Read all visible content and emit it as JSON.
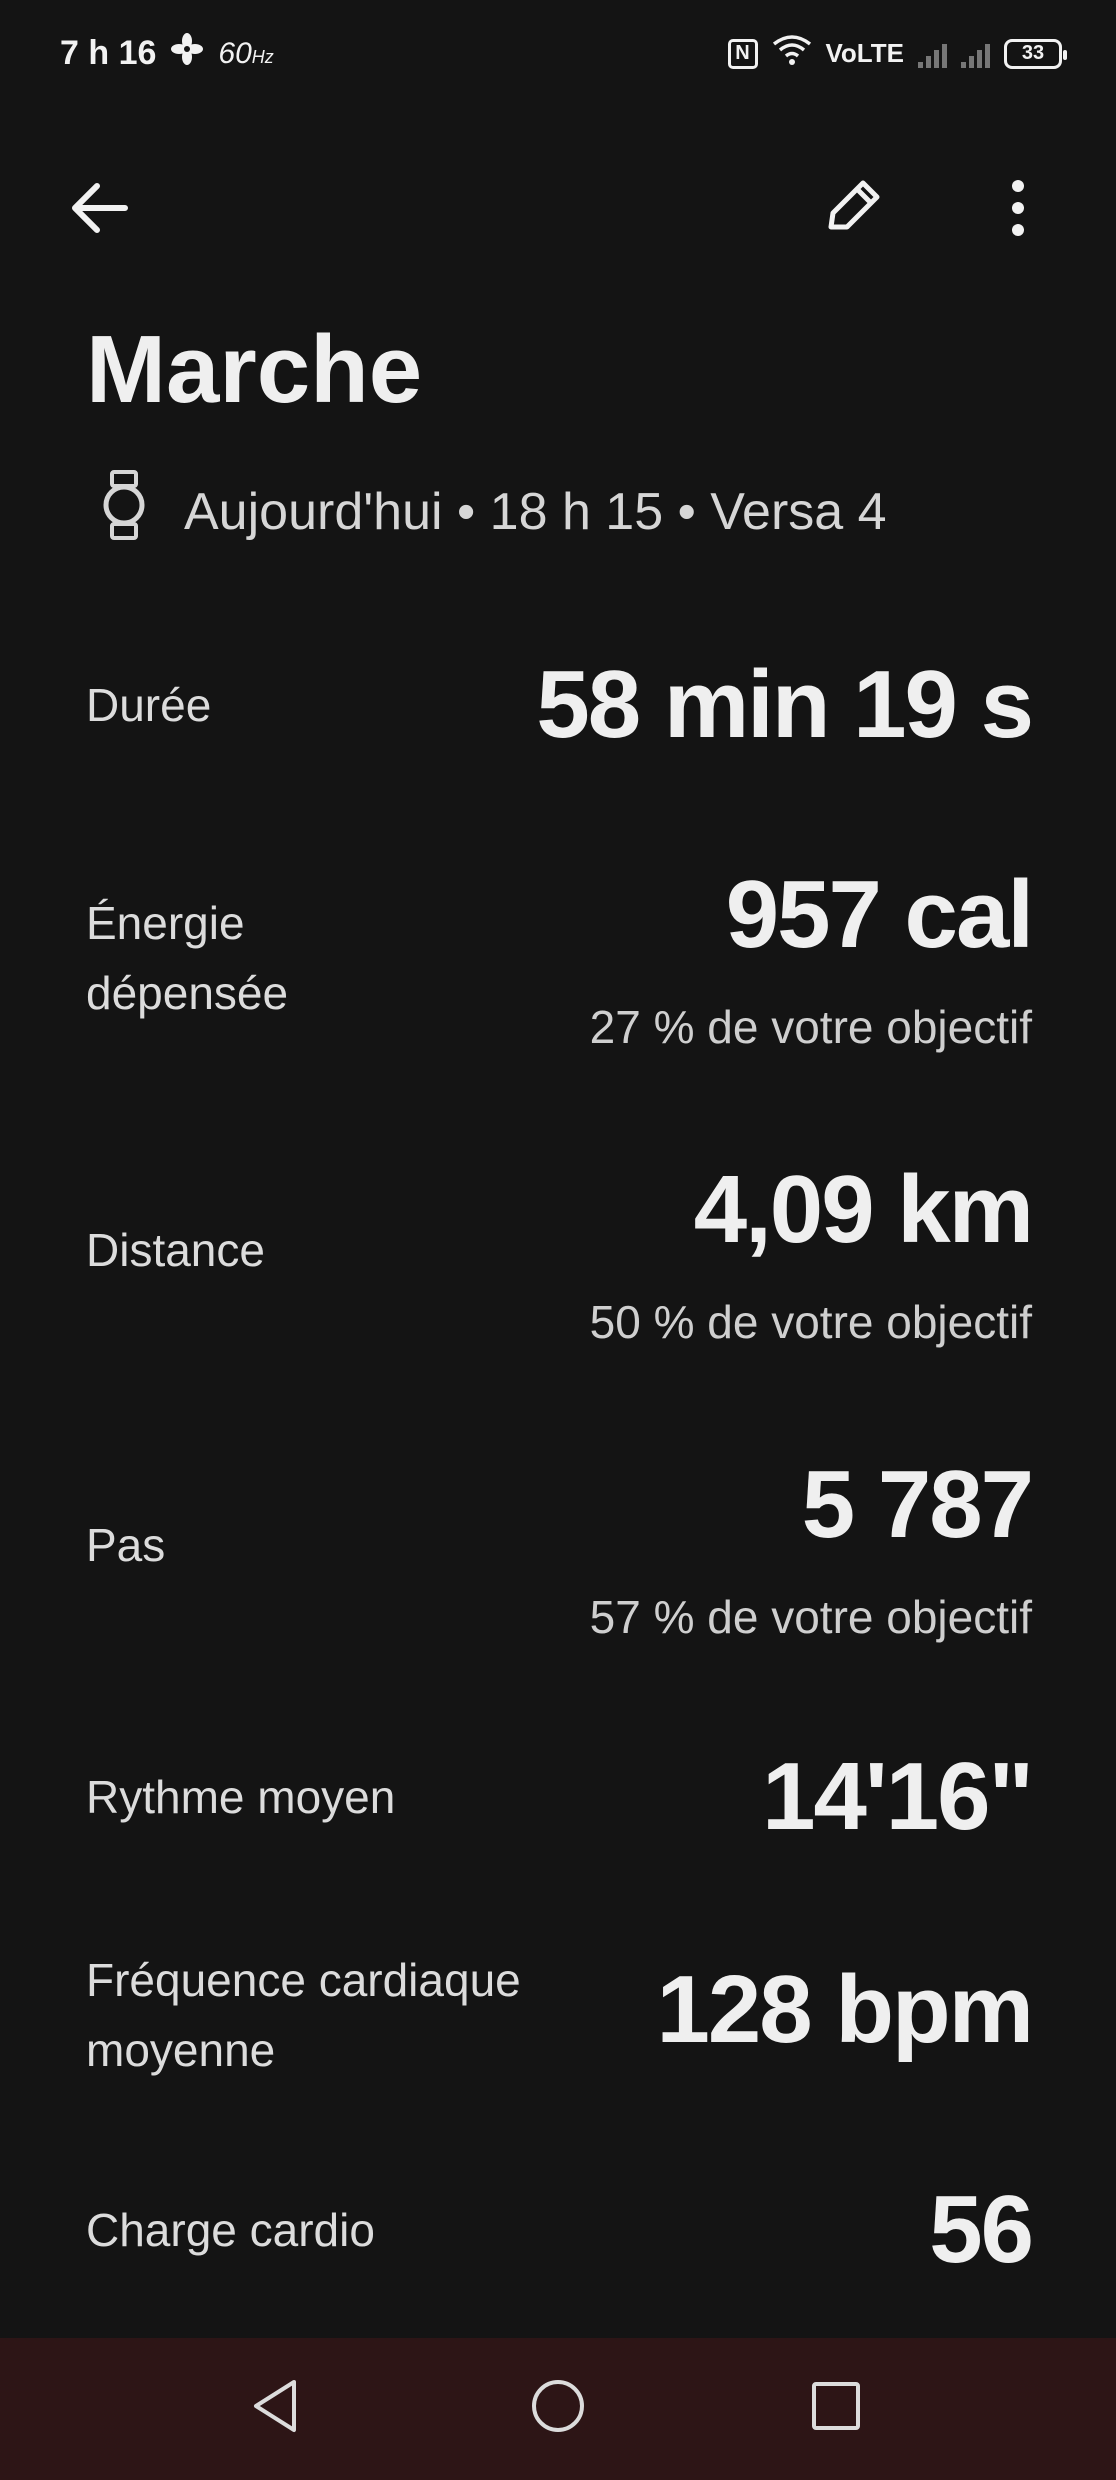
{
  "status_bar": {
    "time": "7 h 16",
    "refresh_rate": "60",
    "refresh_unit": "Hz",
    "nfc_label": "N",
    "network_label": "VoLTE",
    "battery_level": "33"
  },
  "header": {
    "title": "Marche",
    "subtitle": "Aujourd'hui • 18 h 15 • Versa 4"
  },
  "metrics": [
    {
      "label": "Durée",
      "value": "58 min 19 s",
      "sub": ""
    },
    {
      "label": "Énergie dépensée",
      "value": "957 cal",
      "sub": "27 % de votre objectif"
    },
    {
      "label": "Distance",
      "value": "4,09 km",
      "sub": "50 % de votre objectif"
    },
    {
      "label": "Pas",
      "value": "5 787",
      "sub": "57 % de votre objectif"
    },
    {
      "label": "Rythme moyen",
      "value": "14'16\"",
      "sub": ""
    },
    {
      "label": "Fréquence cardiaque moyenne",
      "value": "128 bpm",
      "sub": ""
    },
    {
      "label": "Charge cardio",
      "value": "56",
      "sub": ""
    }
  ],
  "icons": {
    "back": "arrow-left-icon",
    "edit": "pencil-icon",
    "more": "more-vert-icon",
    "device": "watch-icon",
    "nav_back": "triangle-back-icon",
    "nav_home": "circle-home-icon",
    "nav_recents": "square-recents-icon"
  },
  "colors": {
    "background": "#141414",
    "nav_bar": "#2d1516",
    "text_primary": "#efefef",
    "text_secondary": "#cfcfcf"
  }
}
